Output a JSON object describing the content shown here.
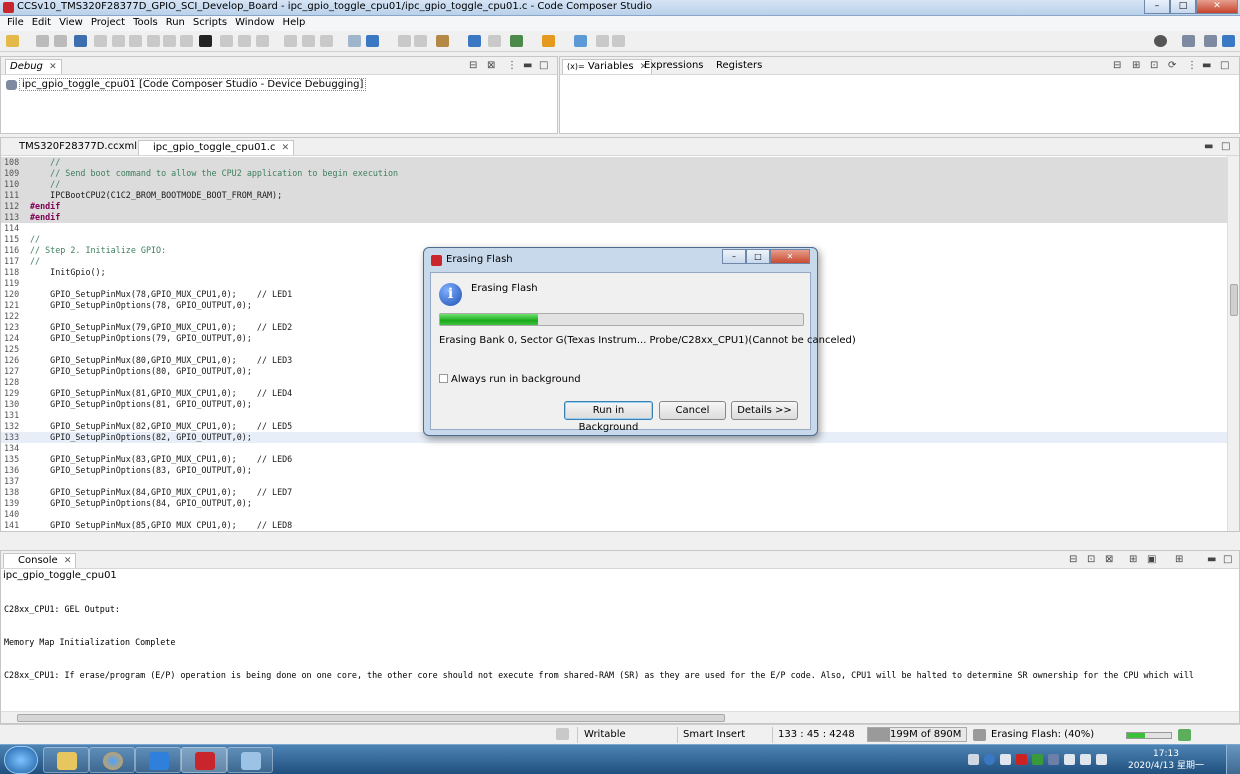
{
  "window": {
    "title": "CCSv10_TMS320F28377D_GPIO_SCI_Develop_Board - ipc_gpio_toggle_cpu01/ipc_gpio_toggle_cpu01.c - Code Composer Studio",
    "min": "–",
    "max": "□",
    "close": "✕"
  },
  "menu": [
    "File",
    "Edit",
    "View",
    "Project",
    "Tools",
    "Run",
    "Scripts",
    "Window",
    "Help"
  ],
  "debug_view": {
    "tab": "Debug",
    "item": "ipc_gpio_toggle_cpu01 [Code Composer Studio - Device Debugging]"
  },
  "variables_view": {
    "tabs": [
      "Variables",
      "Expressions",
      "Registers"
    ],
    "prefix": "(x)="
  },
  "editor": {
    "tabs": [
      "TMS320F28377D.ccxml",
      "ipc_gpio_toggle_cpu01.c"
    ],
    "lines": [
      {
        "n": "108",
        "t": "    //",
        "style": "shaded"
      },
      {
        "n": "109",
        "t": "    // Send boot command to allow the CPU2 application to begin execution",
        "style": "shaded"
      },
      {
        "n": "110",
        "t": "    //",
        "style": "shaded"
      },
      {
        "n": "111",
        "t": "    IPCBootCPU2(C1C2_BROM_BOOTMODE_BOOT_FROM_RAM);",
        "style": "shaded"
      },
      {
        "n": "112",
        "t": "#endif",
        "style": "shaded"
      },
      {
        "n": "113",
        "t": "#endif",
        "style": "shaded"
      },
      {
        "n": "114",
        "t": "",
        "style": ""
      },
      {
        "n": "115",
        "t": "//",
        "style": ""
      },
      {
        "n": "116",
        "t": "// Step 2. Initialize GPIO:",
        "style": ""
      },
      {
        "n": "117",
        "t": "//",
        "style": ""
      },
      {
        "n": "118",
        "t": "    InitGpio();",
        "style": ""
      },
      {
        "n": "119",
        "t": "",
        "style": ""
      },
      {
        "n": "120",
        "t": "    GPIO_SetupPinMux(78,GPIO_MUX_CPU1,0);    // LED1",
        "style": ""
      },
      {
        "n": "121",
        "t": "    GPIO_SetupPinOptions(78, GPIO_OUTPUT,0);",
        "style": ""
      },
      {
        "n": "122",
        "t": "",
        "style": ""
      },
      {
        "n": "123",
        "t": "    GPIO_SetupPinMux(79,GPIO_MUX_CPU1,0);    // LED2",
        "style": ""
      },
      {
        "n": "124",
        "t": "    GPIO_SetupPinOptions(79, GPIO_OUTPUT,0);",
        "style": ""
      },
      {
        "n": "125",
        "t": "",
        "style": ""
      },
      {
        "n": "126",
        "t": "    GPIO_SetupPinMux(80,GPIO_MUX_CPU1,0);    // LED3",
        "style": ""
      },
      {
        "n": "127",
        "t": "    GPIO_SetupPinOptions(80, GPIO_OUTPUT,0);",
        "style": ""
      },
      {
        "n": "128",
        "t": "",
        "style": ""
      },
      {
        "n": "129",
        "t": "    GPIO_SetupPinMux(81,GPIO_MUX_CPU1,0);    // LED4",
        "style": ""
      },
      {
        "n": "130",
        "t": "    GPIO_SetupPinOptions(81, GPIO_OUTPUT,0);",
        "style": ""
      },
      {
        "n": "131",
        "t": "",
        "style": ""
      },
      {
        "n": "132",
        "t": "    GPIO_SetupPinMux(82,GPIO_MUX_CPU1,0);    // LED5",
        "style": ""
      },
      {
        "n": "133",
        "t": "    GPIO_SetupPinOptions(82, GPIO_OUTPUT,0);",
        "style": "current"
      },
      {
        "n": "134",
        "t": "",
        "style": ""
      },
      {
        "n": "135",
        "t": "    GPIO_SetupPinMux(83,GPIO_MUX_CPU1,0);    // LED6",
        "style": ""
      },
      {
        "n": "136",
        "t": "    GPIO_SetupPinOptions(83, GPIO_OUTPUT,0);",
        "style": ""
      },
      {
        "n": "137",
        "t": "",
        "style": ""
      },
      {
        "n": "138",
        "t": "    GPIO_SetupPinMux(84,GPIO_MUX_CPU1,0);    // LED7",
        "style": ""
      },
      {
        "n": "139",
        "t": "    GPIO_SetupPinOptions(84, GPIO_OUTPUT,0);",
        "style": ""
      },
      {
        "n": "140",
        "t": "",
        "style": ""
      },
      {
        "n": "141",
        "t": "    GPIO SetupPinMux(85,GPIO MUX CPU1,0);    // LED8",
        "style": ""
      }
    ]
  },
  "console": {
    "tab": "Console",
    "subtitle": "ipc_gpio_toggle_cpu01",
    "lines": [
      "C28xx_CPU1: GEL Output:",
      "Memory Map Initialization Complete",
      "C28xx_CPU1: If erase/program (E/P) operation is being done on one core, the other core should not execute from shared-RAM (SR) as they are used for the E/P code. Also, CPU1 will be halted to determine SR ownership for the CPU which will"
    ]
  },
  "status": {
    "writable": "Writable",
    "insert_mode": "Smart Insert",
    "position": "133 : 45 : 4248",
    "heap": "199M of 890M",
    "heap_used_fraction": 0.22,
    "job": "Erasing Flash: (40%)"
  },
  "dialog": {
    "title": "Erasing Flash",
    "label": "Erasing Flash",
    "progress_fraction": 0.27,
    "status": "Erasing Bank 0, Sector G(Texas Instrum... Probe/C28xx_CPU1)(Cannot be canceled)",
    "checkbox_label": "Always run in background",
    "btn_background": "Run in Background",
    "btn_cancel": "Cancel",
    "btn_details": "Details >>"
  },
  "taskbar": {
    "time": "17:13",
    "date": "2020/4/13 星期一"
  }
}
